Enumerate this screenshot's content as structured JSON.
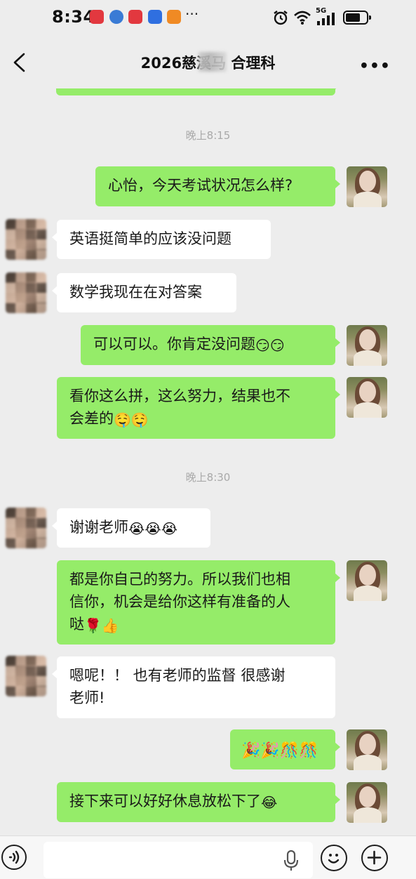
{
  "status_bar": {
    "time": "8:34",
    "more_indicator": "···",
    "network": "5G",
    "battery_level": 0.7
  },
  "nav": {
    "title": "2026慈溪马  合理科",
    "back_icon": "chevron-left-icon",
    "more_icon": "more-horizontal-icon",
    "more_label": "•••"
  },
  "messages": {
    "time1": "晚上8:15",
    "m1": "心怡，今天考试状况怎么样?",
    "m2": "英语挺简单的应该没问题",
    "m3": "数学我现在在对答案",
    "m4": "可以可以。你肯定没问题",
    "m4_emoji": "😏😏",
    "m5a": "看你这么拼，这么努力，结果也不",
    "m5b": "会差的",
    "m5_emoji": "🤤🤤",
    "time2": "晚上8:30",
    "m6": "谢谢老师",
    "m6_emoji": "😭😭😭",
    "m7a": "都是你自己的努力。所以我们也相",
    "m7b": "信你，机会是给你这样有准备的人",
    "m7c": "哒",
    "m7_emoji": "🌹👍",
    "m8a": "嗯呢！！ 也有老师的监督 很感谢",
    "m8b": "老师!",
    "m9_emoji": "🎉🎉🎊🎊",
    "m10": "接下来可以好好休息放松下了",
    "m10_emoji": "😂"
  },
  "input_bar": {
    "placeholder": "",
    "voice_icon": "voice-icon",
    "mic_icon": "microphone-icon",
    "emoji_icon": "emoji-icon",
    "plus_icon": "plus-icon"
  },
  "colors": {
    "background": "#ededed",
    "outgoing_bubble": "#95ec69",
    "incoming_bubble": "#ffffff",
    "timestamp": "#a9a9a9"
  }
}
